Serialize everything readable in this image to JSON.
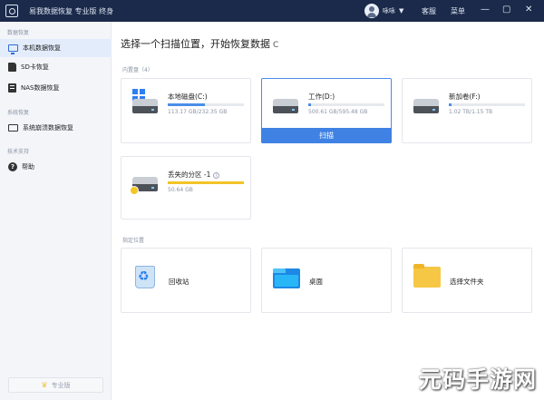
{
  "titlebar": {
    "app_title": "易我数据恢复 专业版 终身",
    "user_name": "咏咏",
    "user_caret": "▼",
    "menu_items": [
      "客服",
      "菜单"
    ],
    "window_buttons": [
      "—",
      "▢",
      "✕"
    ]
  },
  "sidebar": {
    "groups": [
      {
        "label": "数据恢复",
        "items": [
          {
            "label": "本机数据恢复",
            "icon": "monitor-icon",
            "active": true
          },
          {
            "label": "SD卡恢复",
            "icon": "sd-card-icon",
            "active": false
          },
          {
            "label": "NAS数据恢复",
            "icon": "nas-icon",
            "active": false
          }
        ]
      },
      {
        "label": "系统恢复",
        "items": [
          {
            "label": "系统崩溃数据恢复",
            "icon": "monitor-crash-icon",
            "active": false
          }
        ]
      },
      {
        "label": "技术支持",
        "items": [
          {
            "label": "帮助",
            "icon": "help-icon",
            "active": false
          }
        ]
      }
    ],
    "pro_button": "专业版"
  },
  "main": {
    "title": "选择一个扫描位置，开始恢复数据",
    "refresh_glyph": "C",
    "drives_label": "内置盘（4）",
    "drives": [
      {
        "name": "本地磁盘(C:)",
        "size": "113.17 GB/232.35 GB",
        "usage": 0.49,
        "type": "system"
      },
      {
        "name": "工作(D:)",
        "size": "500.61 GB/595.48 GB",
        "usage": 0.04,
        "type": "normal",
        "selected": true,
        "action": "扫描"
      },
      {
        "name": "新加卷(F:)",
        "size": "1.02 TB/1.15 TB",
        "usage": 0.04,
        "type": "normal"
      },
      {
        "name": "丢失的分区 -1",
        "info_glyph": "i",
        "size": "50.64 GB",
        "usage": 1.0,
        "type": "lost"
      }
    ],
    "locations_label": "指定位置",
    "locations": [
      {
        "name": "回收站",
        "icon": "recycle-bin-icon"
      },
      {
        "name": "桌面",
        "icon": "desktop-icon"
      },
      {
        "name": "选择文件夹",
        "icon": "folder-icon"
      }
    ]
  },
  "watermark": "元码手游网",
  "colors": {
    "titlebar": "#1b2a4a",
    "accent": "#3f82e4",
    "lost": "#f2c427"
  }
}
